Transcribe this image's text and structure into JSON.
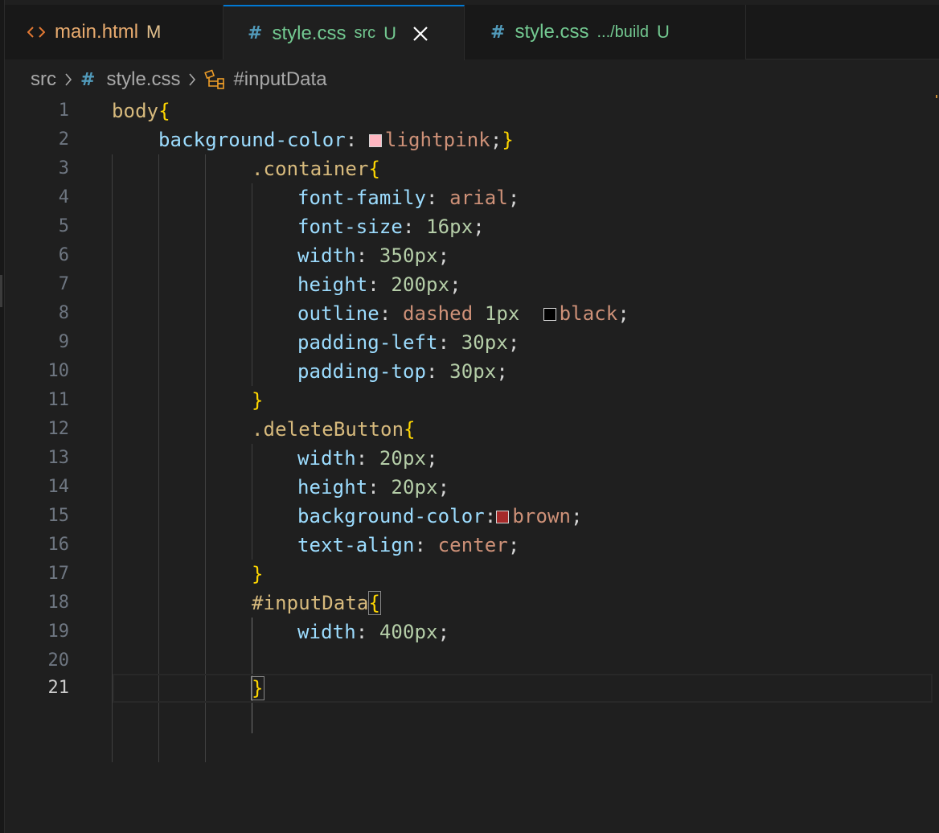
{
  "tabs": [
    {
      "name": "main.html",
      "description": "",
      "status": "M",
      "icon": "html-code-icon",
      "name_color": "#e8ab6f",
      "status_color": "#e2c08d",
      "active": false
    },
    {
      "name": "style.css",
      "description": "src",
      "status": "U",
      "icon": "css-hash-icon",
      "name_color": "#73c991",
      "status_color": "#73c991",
      "active": true
    },
    {
      "name": "style.css",
      "description": ".../build",
      "status": "U",
      "icon": "css-hash-icon",
      "name_color": "#73c991",
      "status_color": "#73c991",
      "active": false
    }
  ],
  "breadcrumb": {
    "folder": "src",
    "file": "style.css",
    "symbol": "#inputData"
  },
  "editor": {
    "current_line": 21,
    "line_numbers": [
      "1",
      "2",
      "3",
      "4",
      "5",
      "6",
      "7",
      "8",
      "9",
      "10",
      "11",
      "12",
      "13",
      "14",
      "15",
      "16",
      "17",
      "18",
      "19",
      "20",
      "21"
    ],
    "lines": [
      "body{",
      "    background-color:  lightpink;}",
      "            .container{",
      "                font-family: arial;",
      "                font-size: 16px;",
      "                width: 350px;",
      "                height: 200px;",
      "                outline: dashed 1px  black;",
      "                padding-left: 30px;",
      "                padding-top: 30px;",
      "            }",
      "            .deleteButton{",
      "                width: 20px;",
      "                height: 20px;",
      "                background-color: brown;",
      "                text-align: center;",
      "            }",
      "            #inputData{",
      "                width: 400px;",
      "",
      "            }"
    ],
    "color_swatches": {
      "lightpink": "#ffb6c1",
      "black": "#000000",
      "brown": "#a52a2a"
    }
  },
  "theme": {
    "selector": "#d7ba7d",
    "property": "#9cdcfe",
    "string_value": "#ce9178",
    "number": "#b5cea8",
    "bracket": "#ffd700",
    "accent": "#0078d4"
  }
}
